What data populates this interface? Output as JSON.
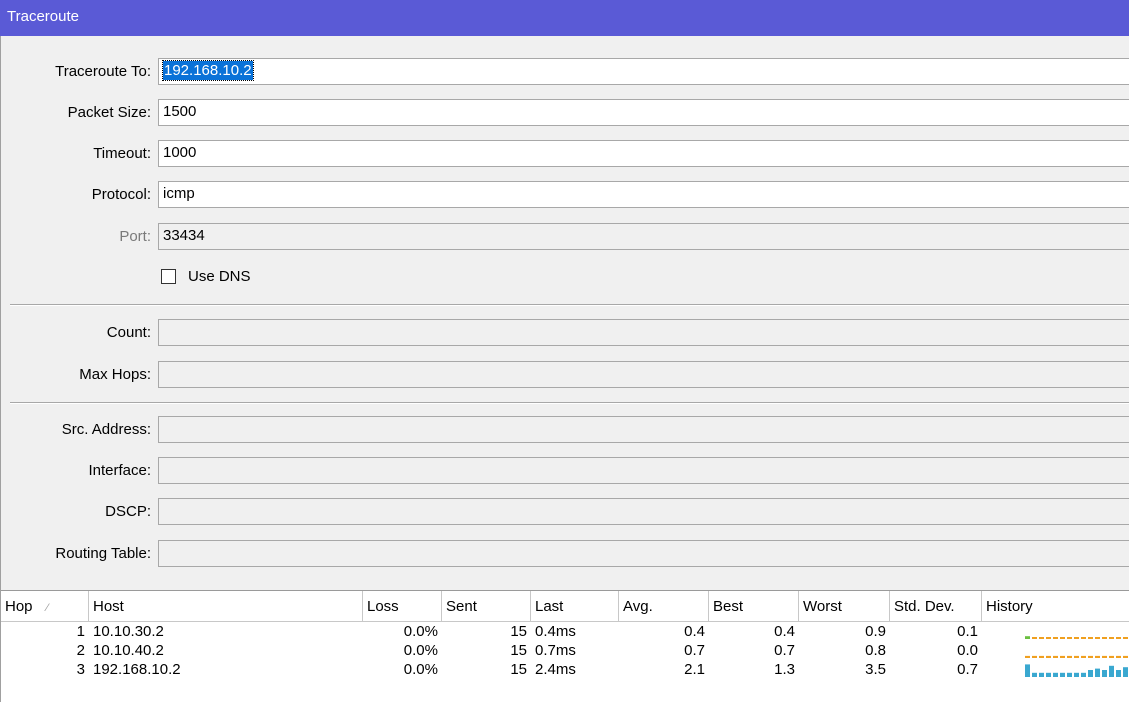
{
  "window": {
    "title": "Traceroute"
  },
  "form": {
    "traceroute_to": {
      "label": "Traceroute To:",
      "value": "192.168.10.2"
    },
    "packet_size": {
      "label": "Packet Size:",
      "value": "1500"
    },
    "timeout": {
      "label": "Timeout:",
      "value": "1000"
    },
    "protocol": {
      "label": "Protocol:",
      "value": "icmp"
    },
    "port": {
      "label": "Port:",
      "value": "33434"
    },
    "use_dns": {
      "label": "Use DNS",
      "checked": false
    },
    "count": {
      "label": "Count:",
      "value": ""
    },
    "max_hops": {
      "label": "Max Hops:",
      "value": ""
    },
    "src_address": {
      "label": "Src. Address:",
      "value": ""
    },
    "interface": {
      "label": "Interface:",
      "value": ""
    },
    "dscp": {
      "label": "DSCP:",
      "value": ""
    },
    "routing_table": {
      "label": "Routing Table:",
      "value": ""
    }
  },
  "table": {
    "columns": [
      "Hop",
      "Host",
      "Loss",
      "Sent",
      "Last",
      "Avg.",
      "Best",
      "Worst",
      "Std. Dev.",
      "History"
    ],
    "rows": [
      {
        "hop": "1",
        "host": "10.10.30.2",
        "loss": "0.0%",
        "sent": "15",
        "last": "0.4ms",
        "avg": "0.4",
        "best": "0.4",
        "worst": "0.9",
        "std": "0.1",
        "history": {
          "color": "#f0a020",
          "bars": [
            0.2,
            0.05,
            0.05,
            0.05,
            0.05,
            0.05,
            0.05,
            0.05,
            0.05,
            0.05,
            0.05,
            0.05,
            0.05,
            0.05,
            0.05
          ],
          "first_color": "#6abf40"
        }
      },
      {
        "hop": "2",
        "host": "10.10.40.2",
        "loss": "0.0%",
        "sent": "15",
        "last": "0.7ms",
        "avg": "0.7",
        "best": "0.7",
        "worst": "0.8",
        "std": "0.0",
        "history": {
          "color": "#f0a020",
          "bars": [
            0.15,
            0.15,
            0.15,
            0.15,
            0.15,
            0.15,
            0.15,
            0.15,
            0.15,
            0.15,
            0.15,
            0.15,
            0.15,
            0.15,
            0.15
          ],
          "first_color": "#f0a020"
        }
      },
      {
        "hop": "3",
        "host": "192.168.10.2",
        "loss": "0.0%",
        "sent": "15",
        "last": "2.4ms",
        "avg": "2.1",
        "best": "1.3",
        "worst": "3.5",
        "std": "0.7",
        "history": {
          "color": "#3aa8d0",
          "bars": [
            0.9,
            0.3,
            0.3,
            0.3,
            0.3,
            0.3,
            0.3,
            0.3,
            0.3,
            0.5,
            0.6,
            0.5,
            0.8,
            0.5,
            0.7
          ],
          "first_color": "#3aa8d0"
        }
      }
    ]
  },
  "icons": {
    "sort": "sort-asc-icon"
  }
}
